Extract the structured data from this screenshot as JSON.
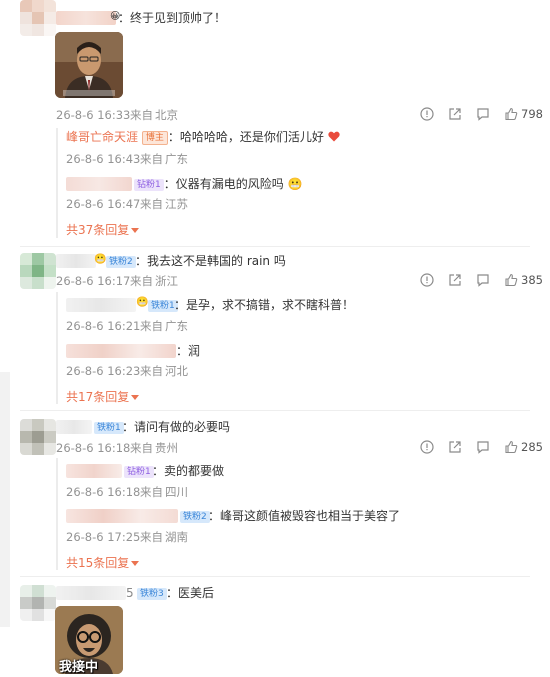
{
  "comments": [
    {
      "text": "：终于见到顶帅了！",
      "timestamp": "26-8-6 16:33",
      "location_prefix": "来自",
      "location": "北京",
      "likes": "798",
      "image_caption": "",
      "replies": [
        {
          "name": "峰哥亡命天涯",
          "badge": "博主",
          "text": "：哈哈哈哈，还是你们活儿好",
          "timestamp": "26-8-6 16:43",
          "location_prefix": "来自",
          "location": "广东"
        },
        {
          "name": "",
          "badge": "钻粉1",
          "text": "：仪器有漏电的风险吗",
          "timestamp": "26-8-6 16:47",
          "location_prefix": "来自",
          "location": "江苏"
        }
      ],
      "more_replies": "共37条回复"
    },
    {
      "badge": "铁粉2",
      "text": "：我去这不是韩国的 rain 吗",
      "timestamp": "26-8-6 16:17",
      "location_prefix": "来自",
      "location": "浙江",
      "likes": "385",
      "replies": [
        {
          "name": "",
          "badge": "铁粉1",
          "text": "：是孕，求不搞错，求不瞎科普！",
          "timestamp": "26-8-6 16:21",
          "location_prefix": "来自",
          "location": "广东"
        },
        {
          "name": "",
          "badge": "",
          "text": "：润",
          "timestamp": "26-8-6 16:23",
          "location_prefix": "来自",
          "location": "河北"
        }
      ],
      "more_replies": "共17条回复"
    },
    {
      "badge": "铁粉1",
      "text": "：请问有做的必要吗",
      "timestamp": "26-8-6 16:18",
      "location_prefix": "来自",
      "location": "贵州",
      "likes": "285",
      "replies": [
        {
          "name": "",
          "badge": "钻粉1",
          "text": "：卖的都要做",
          "timestamp": "26-8-6 16:18",
          "location_prefix": "来自",
          "location": "四川"
        },
        {
          "name": "",
          "badge": "铁粉2",
          "text": "：峰哥这颜值被毁容也相当于美容了",
          "timestamp": "26-8-6 17:25",
          "location_prefix": "来自",
          "location": "湖南"
        }
      ],
      "more_replies": "共15条回复"
    },
    {
      "name_suffix": "5",
      "badge": "铁粉3",
      "text": "：医美后",
      "image_caption": "我接中"
    }
  ],
  "colors": {
    "orange": "#eb7350",
    "meta_gray": "#939393",
    "heart": "#e94b3c"
  },
  "icons": [
    "report-icon",
    "share-icon",
    "comment-icon",
    "like-icon",
    "heart-icon",
    "emoji-icon",
    "chevron-down-icon"
  ]
}
